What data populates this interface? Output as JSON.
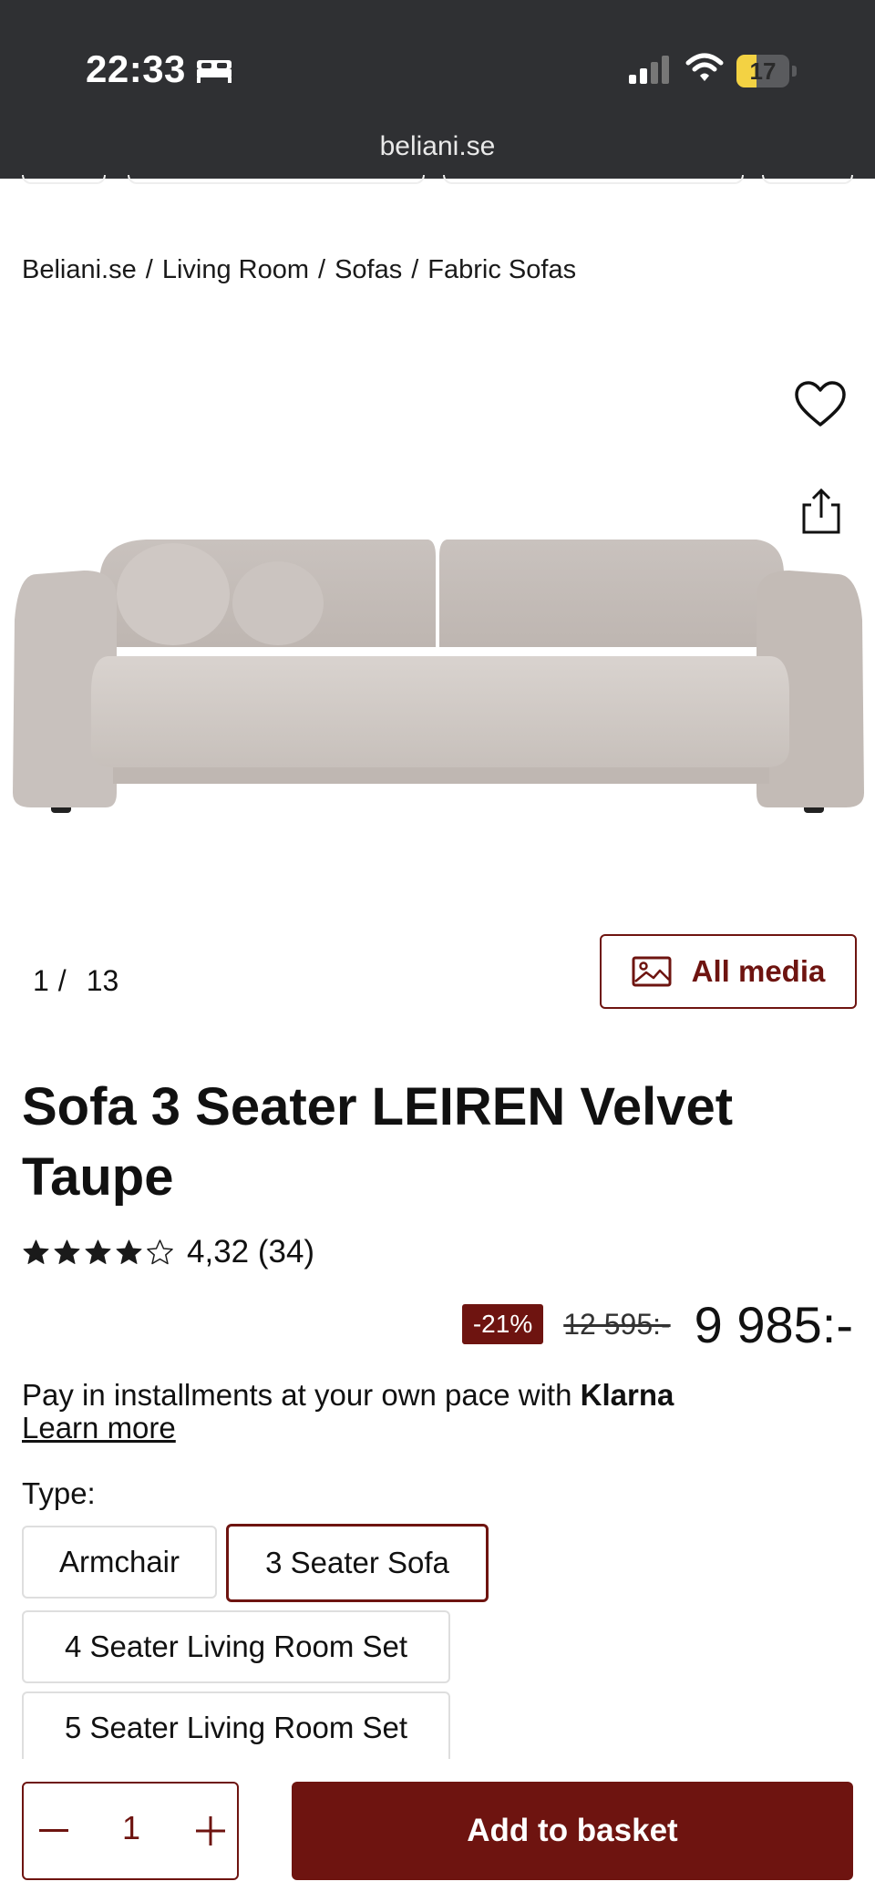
{
  "status_bar": {
    "time": "22:33",
    "battery": "17",
    "battery_color": "#f3d243"
  },
  "browser": {
    "url": "beliani.se"
  },
  "breadcrumb": [
    "Beliani.se",
    "Living Room",
    "Sofas",
    "Fabric Sofas"
  ],
  "breadcrumb_separator": "/",
  "gallery": {
    "current": "1",
    "separator": "/",
    "total": "13",
    "all_media_label": "All media"
  },
  "product": {
    "title": "Sofa 3 Seater LEIREN Velvet Taupe",
    "rating_stars": 4.32,
    "rating_text": "4,32 (34)",
    "discount": "-21%",
    "old_price": "12 595:-",
    "price": "9 985:-"
  },
  "klarna": {
    "text": "Pay in installments at your own pace with",
    "brand": "Klarna",
    "learn_more": "Learn more"
  },
  "type": {
    "label": "Type:",
    "options": [
      "Armchair",
      "3 Seater Sofa",
      "4 Seater Living Room Set",
      "5 Seater Living Room Set"
    ],
    "selected": "3 Seater Sofa"
  },
  "cart": {
    "quantity": "1",
    "add_label": "Add to basket"
  },
  "colors": {
    "brand": "#6e1410",
    "statusbar": "#2f3033",
    "sofa": "#cdc6c2"
  },
  "icons": [
    "bed-icon",
    "signal-icon",
    "wifi-icon",
    "heart-icon",
    "share-icon",
    "image-icon",
    "star-icon",
    "minus-icon",
    "plus-icon"
  ]
}
